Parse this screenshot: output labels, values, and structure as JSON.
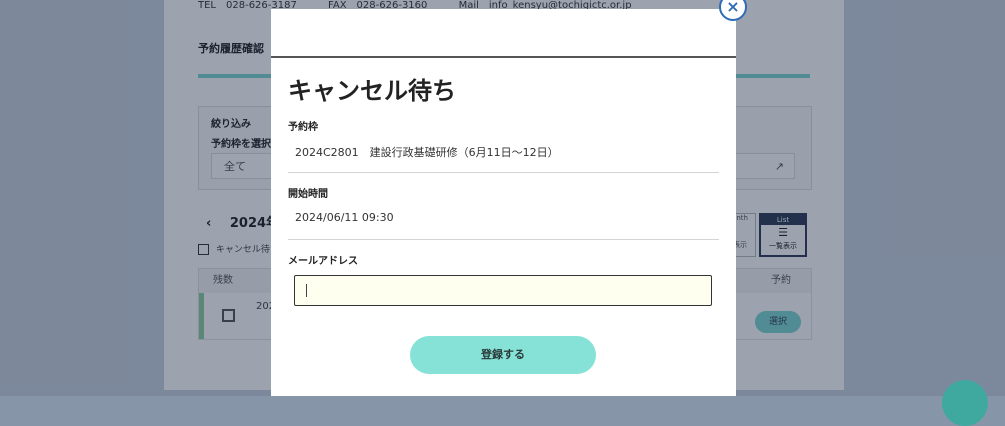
{
  "background": {
    "contact": {
      "tel": "TEL　028-626-3187",
      "fax": "FAX　028-626-3160",
      "mail": "Mail　info_kensyu@tochigictc.or.jp"
    },
    "section_title": "予約履歴確認",
    "filter": {
      "label": "絞り込み",
      "sublabel": "予約枠を選択",
      "select_value": "全て",
      "arrow": "↗"
    },
    "month_nav": {
      "prev": "‹",
      "label": "2024年"
    },
    "cancel_wait_checkbox_label": "キャンセル待ち",
    "view_toggle": {
      "month_header": "onth",
      "month_label": "表示",
      "list_header": "List",
      "list_label": "一覧表示",
      "list_icon": "☰"
    },
    "table": {
      "col_remaining": "残数",
      "col_reserve": "予約",
      "row_date": "202",
      "row_button": "選択"
    }
  },
  "modal": {
    "close_label": "×",
    "title": "キャンセル待ち",
    "fields": {
      "slot_label": "予約枠",
      "slot_value": "2024C2801　建設行政基礎研修（6月11日～12日）",
      "start_label": "開始時間",
      "start_value": "2024/06/11 09:30",
      "email_label": "メールアドレス",
      "email_value": "",
      "email_placeholder": ""
    },
    "submit_label": "登録する"
  },
  "colors": {
    "accent_teal": "#86e2d6",
    "close_blue": "#2f6bb7",
    "input_bg": "#fffff0"
  }
}
